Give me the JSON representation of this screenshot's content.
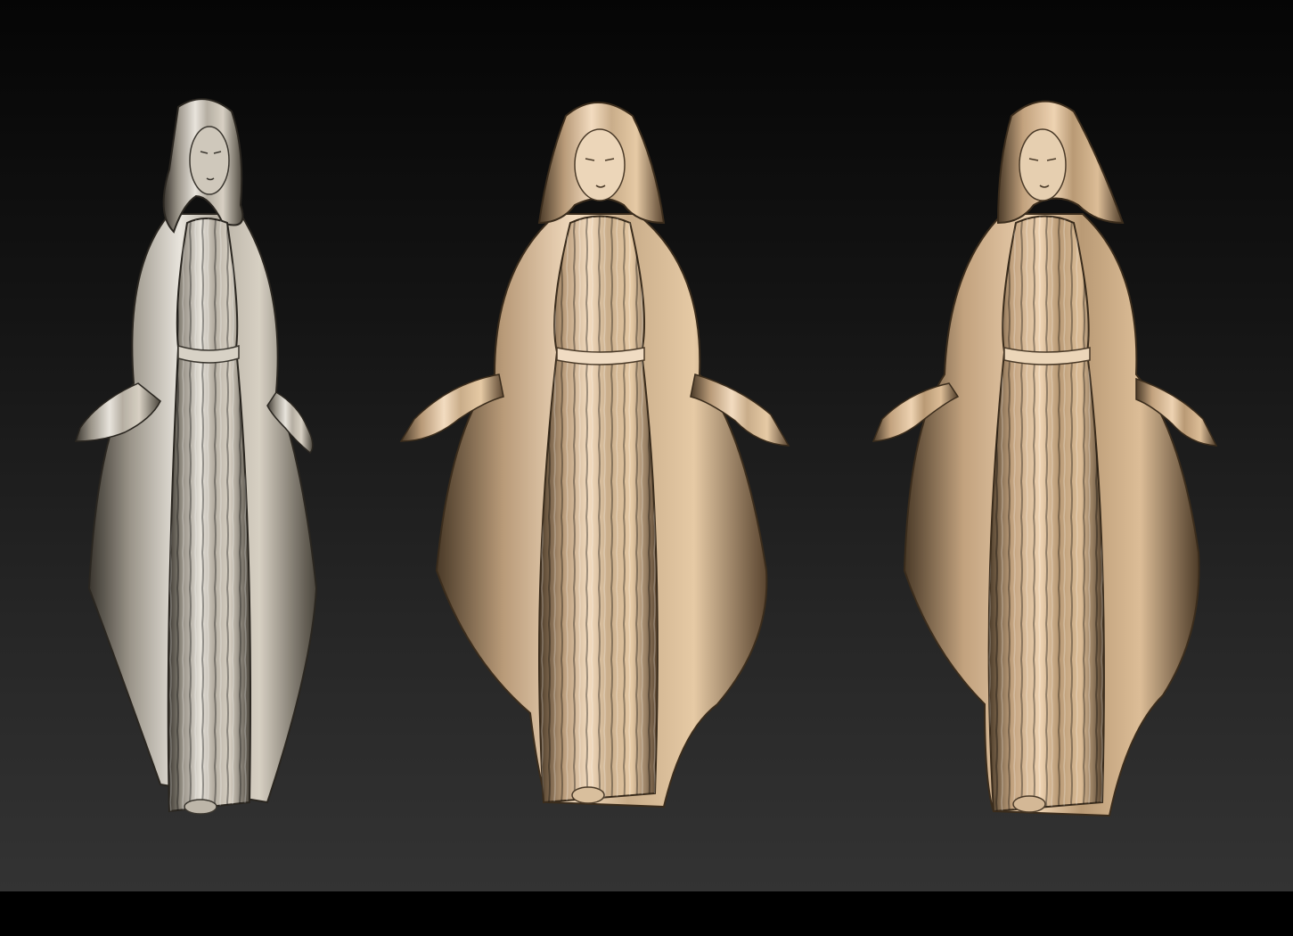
{
  "scene": {
    "statue_count": 3,
    "statues": [
      {
        "id": "left",
        "view": "three-quarter-left",
        "material": "silver-bronze"
      },
      {
        "id": "center",
        "view": "front",
        "material": "gold-bronze"
      },
      {
        "id": "right",
        "view": "three-quarter-right",
        "material": "gold-bronze"
      }
    ],
    "colors": {
      "background_top": "#050505",
      "background_bottom": "#333333",
      "bar": "#000000",
      "silver_light": "#e8e4dc",
      "silver_mid": "#9a9489",
      "silver_dark": "#3a362f",
      "gold_light": "#f3dcc0",
      "gold_mid": "#b89a78",
      "gold_dark": "#4a3a28"
    }
  }
}
